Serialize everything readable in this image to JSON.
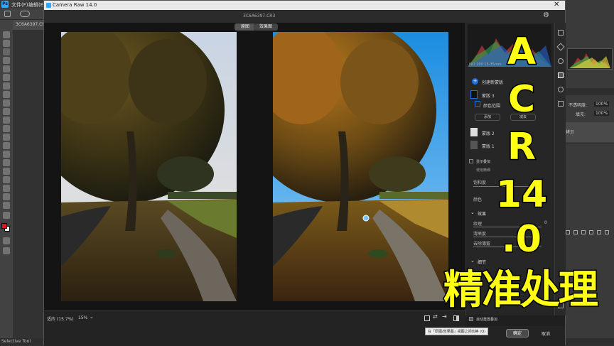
{
  "ps": {
    "menu": [
      "文件(F)",
      "编辑(E)"
    ],
    "doc_tab": "3C6A6397.CR3",
    "layers": {
      "opacity_label": "不透明度:",
      "opacity_value": "100%",
      "fill_label": "填充:",
      "fill_value": "100%",
      "layer_name": "拷贝"
    },
    "status_tool": "Selective Tool"
  },
  "acr": {
    "title": "Camera Raw 14.0",
    "filename": "3C6A6397.CR3",
    "tabs": {
      "before": "原图",
      "after": "效果图"
    },
    "panel": {
      "histogram_info": "ISO 100   15-35mm",
      "create_mask": "创建新蒙版",
      "masks": [
        {
          "label": "蒙版 3"
        },
        {
          "label": "颜色范围"
        },
        {
          "label": "蒙版 2"
        },
        {
          "label": "蒙版 1"
        }
      ],
      "add_btn": "添加",
      "subtract_btn": "减去",
      "overlay_label": "显示叠加",
      "use_fine": "使用精细",
      "saturation": "饱和度",
      "color": "颜色",
      "effects_header": "效果",
      "texture": "纹理",
      "texture_value": "0",
      "clarity": "清晰度",
      "dehaze": "去除薄雾",
      "detail_header": "细节",
      "auto_overlay": "自动重置叠加"
    },
    "zoom_label": "适应 (15.7%)",
    "zoom_value": "15%",
    "tooltip": "在「原图/效果图」视图之间切换 (Q)",
    "ok_button": "确定",
    "cancel_button": "取消"
  },
  "overlay": {
    "letters": [
      "A",
      "C",
      "R",
      "14",
      ".0"
    ],
    "caption": "精准处理"
  }
}
